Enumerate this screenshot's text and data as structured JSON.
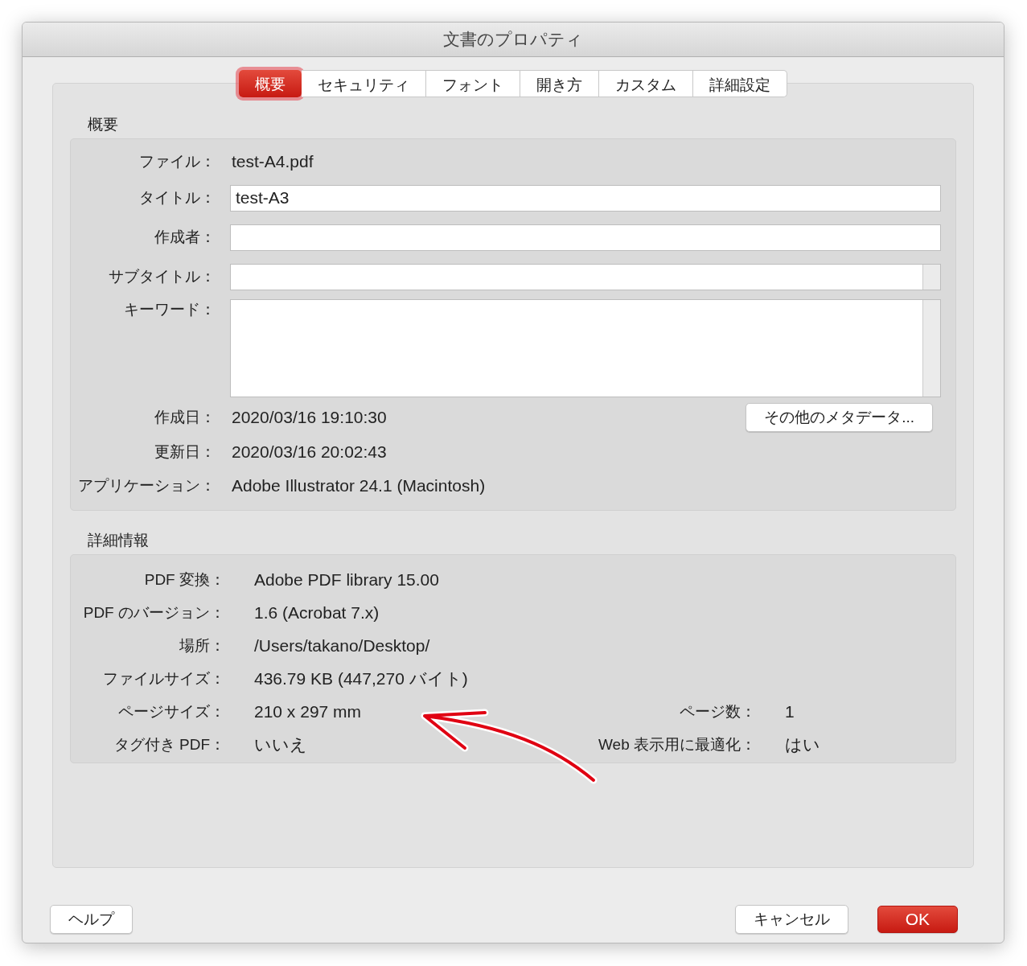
{
  "window": {
    "title": "文書のプロパティ"
  },
  "tabs": [
    {
      "label": "概要",
      "selected": true
    },
    {
      "label": "セキュリティ",
      "selected": false
    },
    {
      "label": "フォント",
      "selected": false
    },
    {
      "label": "開き方",
      "selected": false
    },
    {
      "label": "カスタム",
      "selected": false
    },
    {
      "label": "詳細設定",
      "selected": false
    }
  ],
  "summary": {
    "heading": "概要",
    "fields": [
      {
        "label": "ファイル：",
        "kind": "text",
        "value": "test-A4.pdf"
      },
      {
        "label": "タイトル：",
        "kind": "input",
        "value": "test-A3",
        "scrollbar": false
      },
      {
        "label": "作成者：",
        "kind": "input",
        "scrollbar": false
      },
      {
        "label": "サブタイトル：",
        "kind": "input",
        "scrollbar": true
      },
      {
        "label": "キーワード：",
        "kind": "textarea",
        "scrollbar": true
      },
      {
        "label": "作成日：",
        "kind": "text",
        "value": "2020/03/16 19:10:30",
        "button": "その他のメタデータ..."
      },
      {
        "label": "更新日：",
        "kind": "text",
        "value": "2020/03/16 20:02:43"
      },
      {
        "label": "アプリケーション：",
        "kind": "text",
        "value": "Adobe Illustrator 24.1 (Macintosh)"
      }
    ]
  },
  "details": {
    "heading": "詳細情報",
    "rows": [
      {
        "cells": [
          {
            "label": "PDF 変換：",
            "value": "Adobe PDF library 15.00"
          }
        ]
      },
      {
        "cells": [
          {
            "label": "PDF のバージョン：",
            "value": "1.6 (Acrobat 7.x)"
          }
        ]
      },
      {
        "cells": [
          {
            "label": "場所：",
            "value": "/Users/takano/Desktop/"
          }
        ]
      },
      {
        "cells": [
          {
            "label": "ファイルサイズ：",
            "value": "436.79 KB (447,270 バイト)"
          }
        ]
      },
      {
        "cells": [
          {
            "label": "ページサイズ：",
            "value": "210 x 297 mm"
          },
          {
            "label": "ページ数：",
            "value": "1"
          }
        ]
      },
      {
        "cells": [
          {
            "label": "タグ付き PDF：",
            "value": "いいえ"
          },
          {
            "label": "Web 表示用に最適化：",
            "value": "はい"
          }
        ]
      }
    ]
  },
  "buttons": [
    {
      "label": "ヘルプ",
      "kind": "help"
    },
    {
      "label": "キャンセル",
      "kind": "normal"
    },
    {
      "label": "OK",
      "kind": "default"
    }
  ]
}
